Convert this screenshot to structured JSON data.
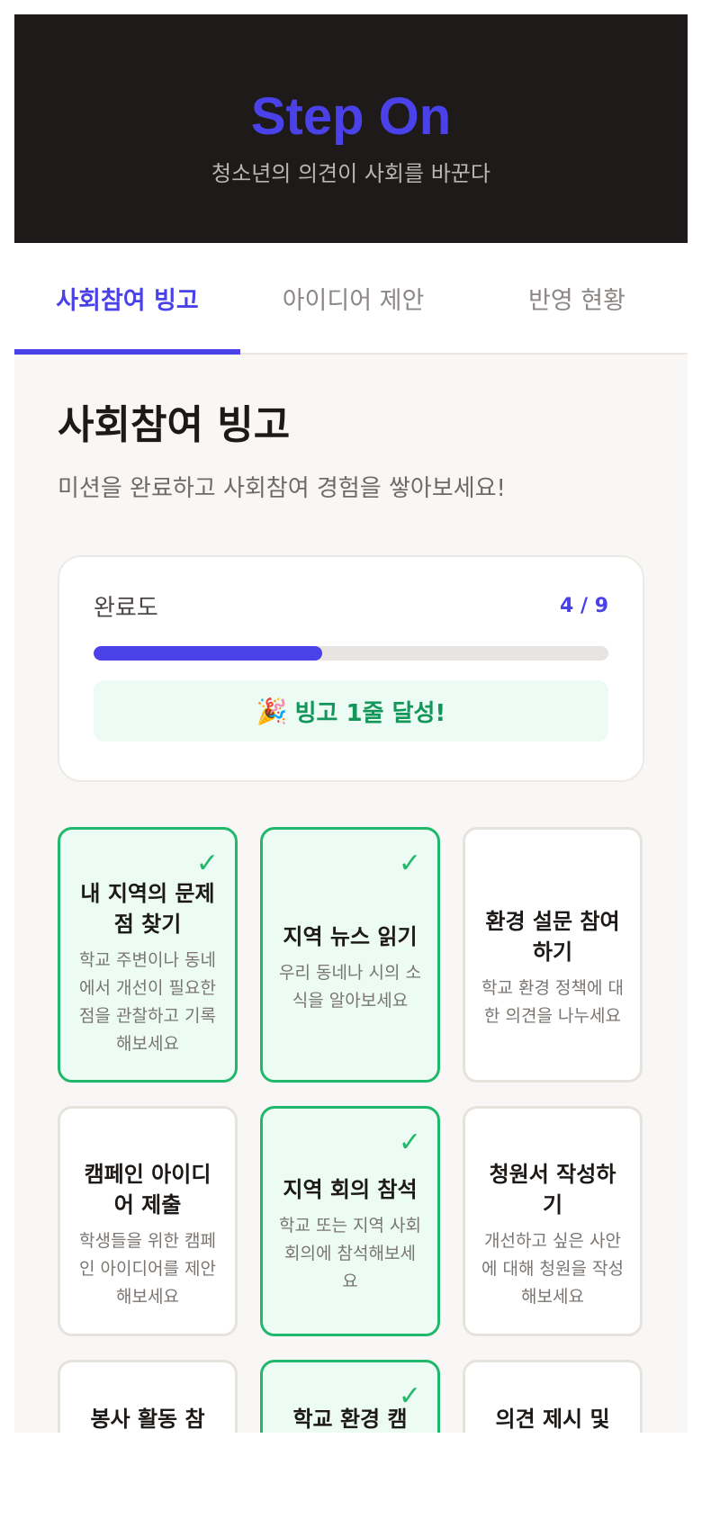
{
  "header": {
    "title": "Step On",
    "subtitle": "청소년의 의견이 사회를 바꾼다"
  },
  "tabs": [
    {
      "label": "사회참여 빙고",
      "active": true
    },
    {
      "label": "아이디어 제안",
      "active": false
    },
    {
      "label": "반영 현황",
      "active": false
    }
  ],
  "section": {
    "title": "사회참여 빙고",
    "subtitle": "미션을 완료하고 사회참여 경험을 쌓아보세요!"
  },
  "progress": {
    "label": "완료도",
    "count_text": "4 / 9",
    "completed": 4,
    "total": 9,
    "fill_fraction": 0.444,
    "achievement_emoji": "🎉",
    "achievement_text": "빙고 1줄 달성!"
  },
  "colors": {
    "accent": "#4a42e8",
    "success": "#20b86a",
    "hero_bg": "#1e1a19"
  },
  "bingo": [
    {
      "title": "내 지역의 문제점 찾기",
      "desc": "학교 주변이나 동네에서 개선이 필요한 점을 관찰하고 기록해보세요",
      "done": true,
      "icon": "check-icon"
    },
    {
      "title": "지역 뉴스 읽기",
      "desc": "우리 동네나 시의 소식을 알아보세요",
      "done": true,
      "icon": "check-icon"
    },
    {
      "title": "환경 설문 참여하기",
      "desc": "학교 환경 정책에 대한 의견을 나누세요",
      "done": false
    },
    {
      "title": "캠페인 아이디어 제출",
      "desc": "학생들을 위한 캠페인 아이디어를 제안해보세요",
      "done": false
    },
    {
      "title": "지역 회의 참석",
      "desc": "학교 또는 지역 사회 회의에 참석해보세요",
      "done": true,
      "icon": "check-icon"
    },
    {
      "title": "청원서 작성하기",
      "desc": "개선하고 싶은 사안에 대해 청원을 작성해보세요",
      "done": false
    },
    {
      "title": "봉사 활동 참",
      "desc": "",
      "done": false
    },
    {
      "title": "학교 환경 캠",
      "desc": "",
      "done": true,
      "icon": "check-icon"
    },
    {
      "title": "의견 제시 및",
      "desc": "",
      "done": false
    }
  ],
  "check_glyph": "✓"
}
